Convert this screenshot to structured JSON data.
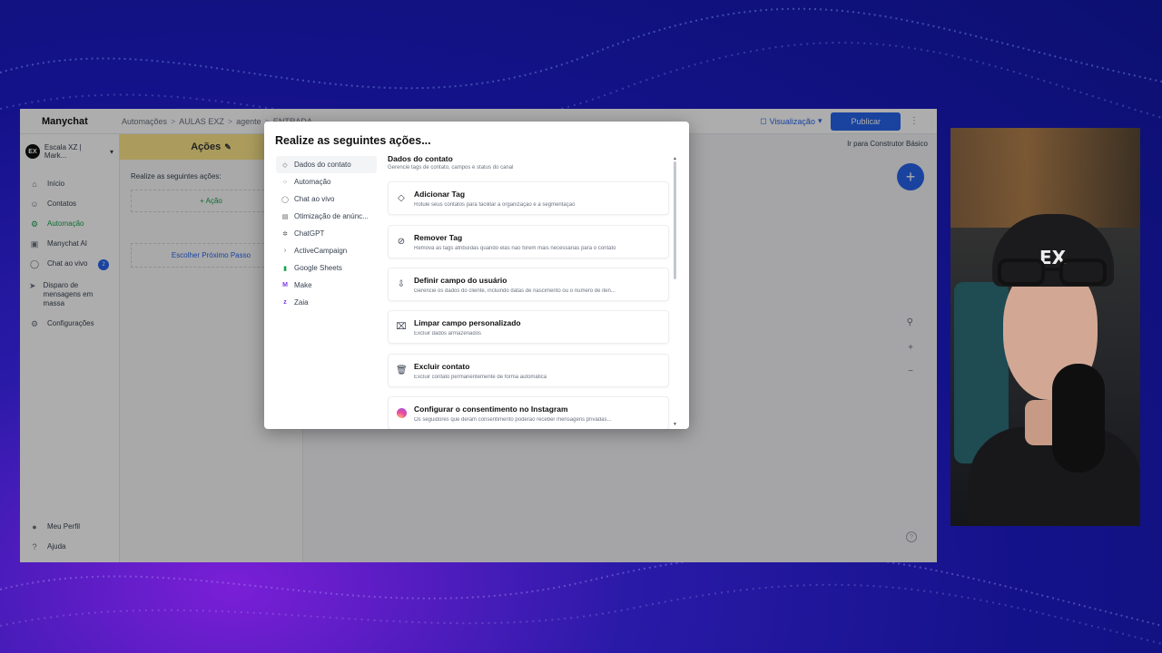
{
  "app": {
    "logo": "Manychat",
    "breadcrumb": [
      "Automações",
      "AULAS EXZ",
      "agente",
      "ENTRADA"
    ],
    "visualize_label": "Visualização",
    "publish_label": "Publicar",
    "builder_link": "Ir para Construtor Básico",
    "account_name": "Escala XZ | Mark...",
    "account_initials": "EX"
  },
  "sidebar": {
    "items": [
      {
        "label": "Início",
        "icon": "home-icon"
      },
      {
        "label": "Contatos",
        "icon": "contacts-icon"
      },
      {
        "label": "Automação",
        "icon": "automation-icon"
      },
      {
        "label": "Manychat AI",
        "icon": "ai-icon"
      },
      {
        "label": "Chat ao vivo",
        "icon": "chat-icon",
        "badge": "2"
      },
      {
        "label": "Disparo de mensagens em massa",
        "icon": "broadcast-icon"
      },
      {
        "label": "Configurações",
        "icon": "settings-icon"
      }
    ],
    "bottom": [
      {
        "label": "Meu Perfil",
        "icon": "profile-icon"
      },
      {
        "label": "Ajuda",
        "icon": "help-icon"
      }
    ]
  },
  "editor": {
    "title": "Ações",
    "subtitle": "Realize as seguintes ações:",
    "add_action": "+ Ação",
    "next_step": "Escolher Próximo Passo"
  },
  "modal": {
    "title": "Realize as seguintes ações...",
    "categories": [
      {
        "label": "Dados do contato",
        "icon": "tag-icon"
      },
      {
        "label": "Automação",
        "icon": "automation-icon"
      },
      {
        "label": "Chat ao vivo",
        "icon": "chat-icon"
      },
      {
        "label": "Otimização de anúnc...",
        "icon": "ads-icon"
      },
      {
        "label": "ChatGPT",
        "icon": "chatgpt-icon"
      },
      {
        "label": "ActiveCampaign",
        "icon": "activecampaign-icon"
      },
      {
        "label": "Google Sheets",
        "icon": "sheets-icon"
      },
      {
        "label": "Make",
        "icon": "make-icon"
      },
      {
        "label": "Zaia",
        "icon": "zaia-icon"
      }
    ],
    "section_title": "Dados do contato",
    "section_subtitle": "Gerencie tags de contato, campos e status do canal",
    "actions": [
      {
        "title": "Adicionar Tag",
        "desc": "Rotule seus contatos para facilitar a organização e a segmentação",
        "icon": "tag-icon"
      },
      {
        "title": "Remover Tag",
        "desc": "Remova as tags atribuídas quando elas não forem mais necessárias para o contato",
        "icon": "tag-remove-icon"
      },
      {
        "title": "Definir campo do usuário",
        "desc": "Gerencie os dados do cliente, incluindo datas de nascimento ou o número de iten...",
        "icon": "field-icon"
      },
      {
        "title": "Limpar campo personalizado",
        "desc": "Excluir dados armazenados",
        "icon": "clear-field-icon"
      },
      {
        "title": "Excluir contato",
        "desc": "Excluir contato permanentemente de forma automática",
        "icon": "trash-icon"
      },
      {
        "title": "Configurar o consentimento no Instagram",
        "desc": "Os seguidores que deram consentimento poderão receber mensagens privadas...",
        "icon": "instagram-icon"
      }
    ]
  }
}
